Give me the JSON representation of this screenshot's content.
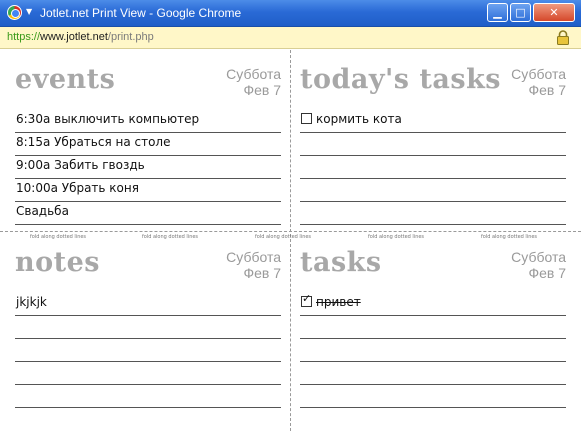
{
  "window": {
    "title": "Jotlet.net Print View - Google Chrome",
    "minimize_label": "▁",
    "maximize_label": "□",
    "close_label": "✕"
  },
  "address": {
    "scheme": "https://",
    "host": "www.jotlet.net",
    "path": "/print.php"
  },
  "fold_label": "fold along dotted lines",
  "date": {
    "day": "Суббота",
    "date": "Фев 7"
  },
  "events": {
    "title": "events",
    "items": [
      "6:30a выключить компьютер",
      "8:15a Убраться на столе",
      "9:00a Забить гвоздь",
      "10:00a Убрать коня",
      "Свадьба"
    ]
  },
  "todays_tasks": {
    "title": "today's tasks",
    "items": [
      {
        "text": "кормить кота",
        "checked": false
      },
      {
        "text": "",
        "checked": null
      },
      {
        "text": "",
        "checked": null
      },
      {
        "text": "",
        "checked": null
      },
      {
        "text": "",
        "checked": null
      }
    ]
  },
  "notes": {
    "title": "notes",
    "items": [
      "jkjkjk",
      "",
      "",
      "",
      ""
    ]
  },
  "tasks": {
    "title": "tasks",
    "items": [
      {
        "text": "привет",
        "checked": true
      },
      {
        "text": "",
        "checked": null
      },
      {
        "text": "",
        "checked": null
      },
      {
        "text": "",
        "checked": null
      },
      {
        "text": "",
        "checked": null
      }
    ]
  }
}
